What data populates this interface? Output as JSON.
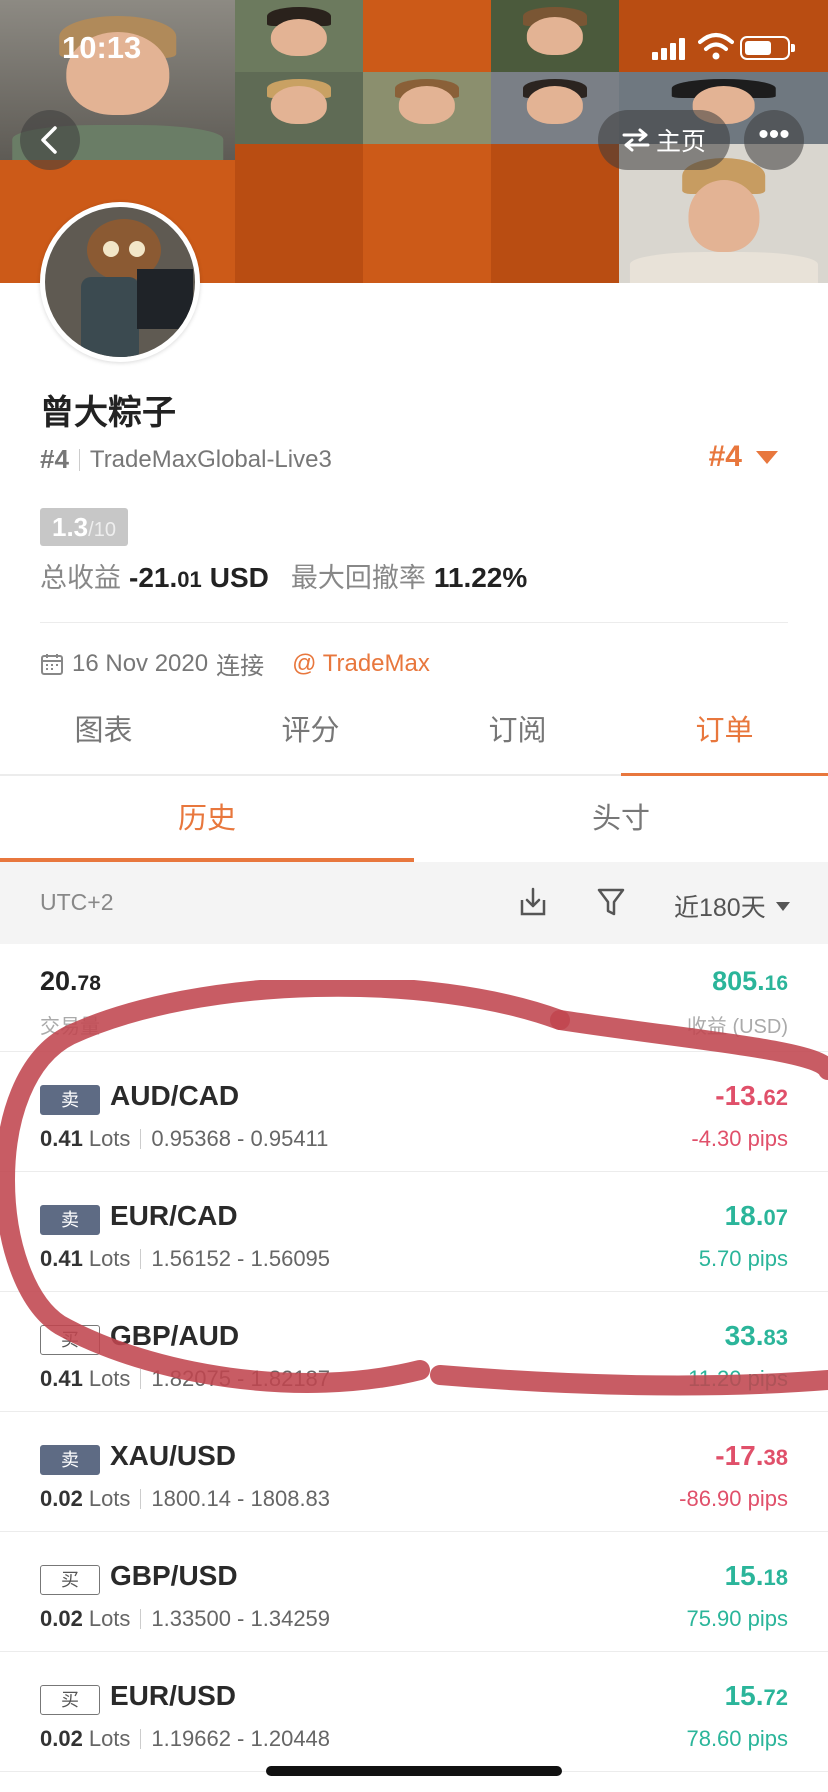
{
  "status_bar": {
    "time": "10:13"
  },
  "nav": {
    "home_label": "主页",
    "more_label": "•••"
  },
  "profile": {
    "name": "曾大粽子",
    "rank": "#4",
    "server": "TradeMaxGlobal-Live3",
    "rank_right": "#4",
    "score": "1.3",
    "score_max": "/10",
    "total_profit_label": "总收益",
    "total_profit_int": "-21.",
    "total_profit_dec": "01",
    "currency": "USD",
    "max_drawdown_label": "最大回撤率",
    "max_drawdown": "11.22%",
    "connect_date": "16 Nov 2020",
    "connect_label": "连接",
    "broker": "TradeMax"
  },
  "tabs": [
    "图表",
    "评分",
    "订阅",
    "订单"
  ],
  "subtabs": [
    "历史",
    "头寸"
  ],
  "filter": {
    "timezone": "UTC+2",
    "range": "近180天"
  },
  "summary": {
    "left_int": "20.",
    "left_dec": "78",
    "left_label": "交易量",
    "right_int": "805.",
    "right_dec": "16",
    "right_label": "收益 (USD)"
  },
  "trades": [
    {
      "side": "卖",
      "symbol": "AUD/CAD",
      "lots": "0.41",
      "lots_label": "Lots",
      "range": "0.95368 - 0.95411",
      "profit_int": "-13.",
      "profit_dec": "62",
      "pips": "-4.30 pips"
    },
    {
      "side": "卖",
      "symbol": "EUR/CAD",
      "lots": "0.41",
      "lots_label": "Lots",
      "range": "1.56152 - 1.56095",
      "profit_int": "18.",
      "profit_dec": "07",
      "pips": "5.70 pips"
    },
    {
      "side": "买",
      "symbol": "GBP/AUD",
      "lots": "0.41",
      "lots_label": "Lots",
      "range": "1.82075 - 1.82187",
      "profit_int": "33.",
      "profit_dec": "83",
      "pips": "11.20 pips"
    },
    {
      "side": "卖",
      "symbol": "XAU/USD",
      "lots": "0.02",
      "lots_label": "Lots",
      "range": "1800.14 - 1808.83",
      "profit_int": "-17.",
      "profit_dec": "38",
      "pips": "-86.90 pips"
    },
    {
      "side": "买",
      "symbol": "GBP/USD",
      "lots": "0.02",
      "lots_label": "Lots",
      "range": "1.33500 - 1.34259",
      "profit_int": "15.",
      "profit_dec": "18",
      "pips": "75.90 pips"
    },
    {
      "side": "买",
      "symbol": "EUR/USD",
      "lots": "0.02",
      "lots_label": "Lots",
      "range": "1.19662 - 1.20448",
      "profit_int": "15.",
      "profit_dec": "72",
      "pips": "78.60 pips"
    }
  ],
  "colors": {
    "accent": "#e8773d",
    "profit": "#2bb59a",
    "loss": "#e0506a",
    "sell_badge": "#5e6b84",
    "annotation": "#c0454e"
  }
}
